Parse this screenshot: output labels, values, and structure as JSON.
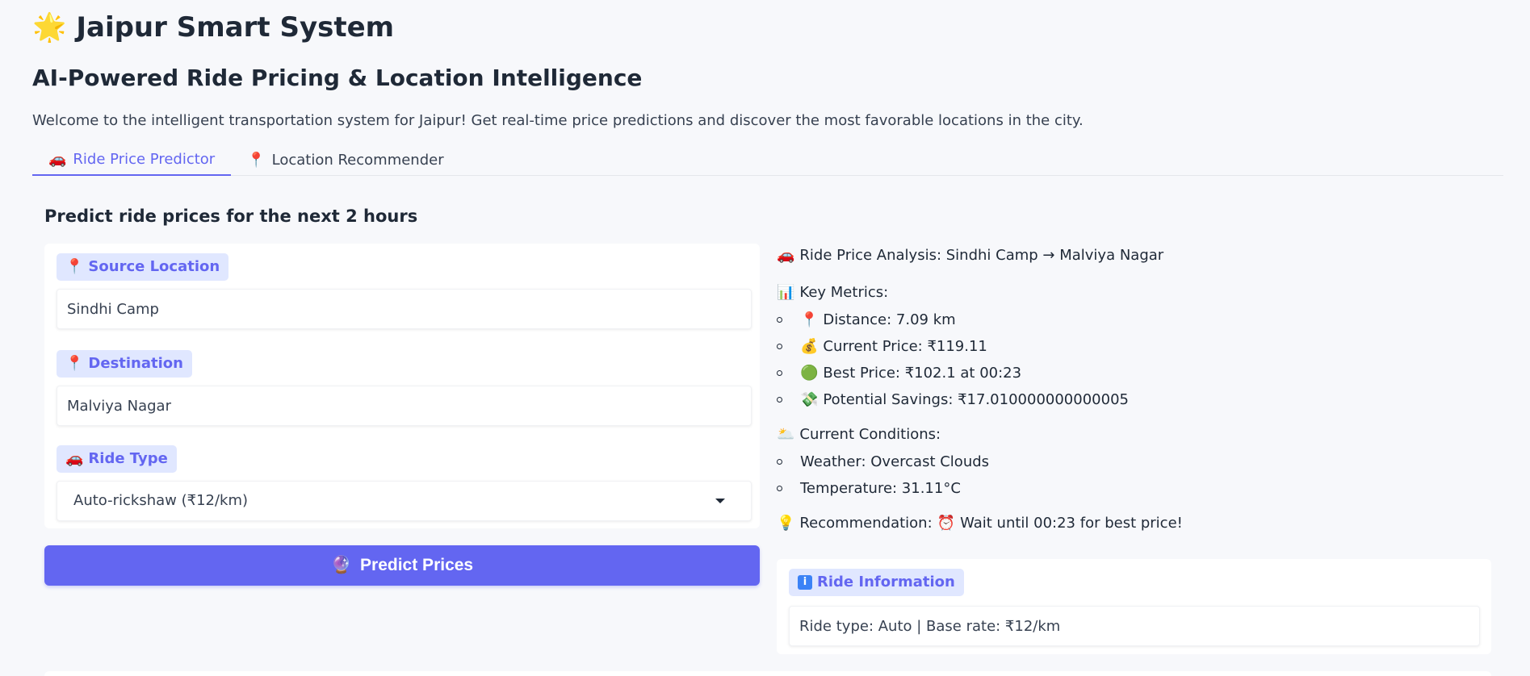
{
  "header": {
    "title_icon": "🌟",
    "title": "Jaipur Smart System",
    "subtitle": "AI-Powered Ride Pricing & Location Intelligence",
    "welcome": "Welcome to the intelligent transportation system for Jaipur! Get real-time price predictions and discover the most favorable locations in the city."
  },
  "tabs": [
    {
      "icon": "🚗",
      "label": "Ride Price Predictor",
      "active": true
    },
    {
      "icon": "📍",
      "label": "Location Recommender",
      "active": false
    }
  ],
  "predictor": {
    "section_title": "Predict ride prices for the next 2 hours",
    "source": {
      "icon": "📍",
      "label": "Source Location",
      "value": "Sindhi Camp"
    },
    "destination": {
      "icon": "📍",
      "label": "Destination",
      "value": "Malviya Nagar"
    },
    "ride_type": {
      "icon": "🚗",
      "label": "Ride Type",
      "value": "Auto-rickshaw (₹12/km)"
    },
    "predict_button": {
      "icon": "🔮",
      "label": "Predict Prices"
    }
  },
  "analysis": {
    "heading_icon": "🚗",
    "heading": "Ride Price Analysis: Sindhi Camp → Malviya Nagar",
    "metrics_icon": "📊",
    "metrics_title": "Key Metrics:",
    "metrics": [
      {
        "icon": "📍",
        "text": "Distance: 7.09 km"
      },
      {
        "icon": "💰",
        "text": "Current Price: ₹119.11"
      },
      {
        "icon": "🟢",
        "text": "Best Price: ₹102.1 at 00:23"
      },
      {
        "icon": "💸",
        "text": "Potential Savings: ₹17.010000000000005"
      }
    ],
    "conditions_icon": "🌥️",
    "conditions_title": "Current Conditions:",
    "conditions": [
      {
        "text": "Weather: Overcast Clouds"
      },
      {
        "text": "Temperature: 31.11°C"
      }
    ],
    "recommendation_icon": "💡",
    "recommendation_label": "Recommendation:",
    "recommendation_alarm_icon": "⏰",
    "recommendation_text": "Wait until 00:23 for best price!"
  },
  "ride_info": {
    "label": "Ride Information",
    "icon_glyph": "i",
    "text": "Ride type: Auto | Base rate: ₹12/km"
  },
  "colors": {
    "accent": "#6366f1",
    "label_bg": "#e0e7ff",
    "background": "#f7f8fb"
  }
}
